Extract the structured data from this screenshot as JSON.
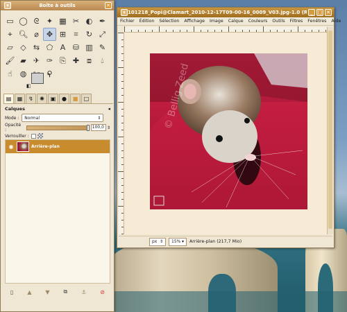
{
  "toolbox": {
    "title": "Boîte à outils",
    "tools": [
      "rect-select-icon",
      "ellipse-select-icon",
      "free-select-icon",
      "fuzzy-select-icon",
      "select-by-color-icon",
      "scissors-select-icon",
      "foreground-select-icon",
      "paths-icon",
      "color-picker-icon",
      "zoom-icon",
      "measure-icon",
      "move-icon",
      "align-icon",
      "crop-icon",
      "rotate-icon",
      "scale-icon",
      "shear-icon",
      "perspective-icon",
      "flip-icon",
      "cage-icon",
      "text-icon",
      "bucket-fill-icon",
      "blend-icon",
      "pencil-icon",
      "paintbrush-icon",
      "eraser-icon",
      "airbrush-icon",
      "ink-icon",
      "clone-icon",
      "heal-icon",
      "perspective-clone-icon",
      "blur-icon",
      "smudge-icon",
      "dodge-burn-icon",
      "scissors-icon",
      "dropper-icon"
    ],
    "layers": {
      "title": "Calques",
      "mode_label": "Mode :",
      "mode_value": "Normal",
      "opacity_label": "Opacité :",
      "opacity_value": "100,0",
      "lock_label": "Verrouiller :",
      "layer_name": "Arrière-plan"
    }
  },
  "image_window": {
    "title": "101218_Popi@Clamart_2010-12-17T09-00-16_0009_V03.jpg-1.0 (RVB,...",
    "menus": [
      "Fichier",
      "Édition",
      "Sélection",
      "Affichage",
      "Image",
      "Calque",
      "Couleurs",
      "Outils",
      "Filtres",
      "Fenêtres",
      "Aide"
    ],
    "unit": "px",
    "zoom": "15%",
    "status": "Arrière-plan (217,7 Mio)",
    "watermark": "© Bellig Zeed"
  },
  "colors": {
    "accent": "#c88c2e",
    "image_bg": "#b4183a",
    "canvas_bg": "#f7ebd6"
  }
}
